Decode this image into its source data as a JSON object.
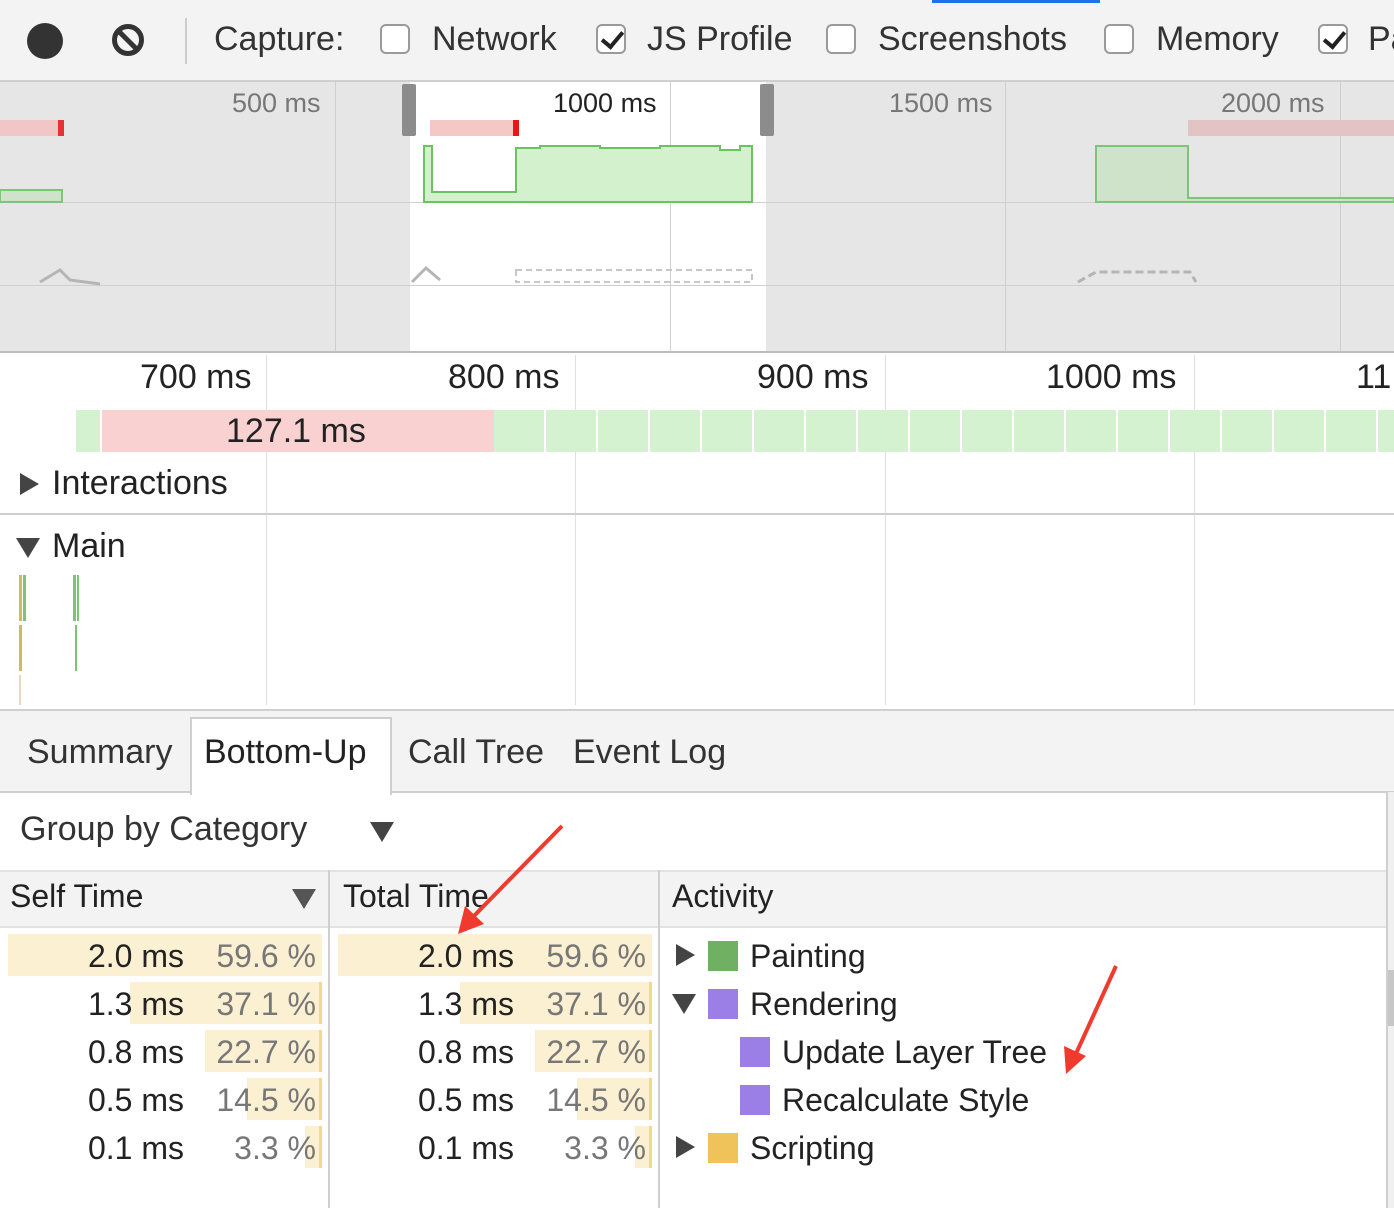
{
  "toolbar": {
    "capture_label": "Capture:",
    "options": [
      {
        "label": "Network",
        "checked": false
      },
      {
        "label": "JS Profile",
        "checked": true
      },
      {
        "label": "Screenshots",
        "checked": false
      },
      {
        "label": "Memory",
        "checked": false
      },
      {
        "label": "Pa",
        "checked": true
      }
    ],
    "icons": [
      "record-icon",
      "clear-icon"
    ]
  },
  "overview": {
    "tick_labels": [
      "500 ms",
      "1000 ms",
      "1500 ms",
      "2000 ms"
    ]
  },
  "flamechart": {
    "tick_labels": [
      "700 ms",
      "800 ms",
      "900 ms",
      "1000 ms",
      "11"
    ],
    "long_frame_label": "127.1 ms",
    "sections": {
      "interactions": "Interactions",
      "main": "Main"
    }
  },
  "tabs": [
    "Summary",
    "Bottom-Up",
    "Call Tree",
    "Event Log"
  ],
  "active_tab": "Bottom-Up",
  "grouping": {
    "selected": "Group by Category"
  },
  "table": {
    "columns": {
      "self_time": "Self Time",
      "total_time": "Total Time",
      "activity": "Activity"
    },
    "rows": [
      {
        "self": "2.0 ms",
        "self_pct": "59.6 %",
        "total": "2.0 ms",
        "total_pct": "59.6 %",
        "pct": 59.6,
        "activity": "Painting",
        "color": "#6fb062",
        "expander": "collapsed"
      },
      {
        "self": "1.3 ms",
        "self_pct": "37.1 %",
        "total": "1.3 ms",
        "total_pct": "37.1 %",
        "pct": 37.1,
        "activity": "Rendering",
        "color": "#9b7fe6",
        "expander": "expanded"
      },
      {
        "self": "0.8 ms",
        "self_pct": "22.7 %",
        "total": "0.8 ms",
        "total_pct": "22.7 %",
        "pct": 22.7,
        "activity": "Update Layer Tree",
        "color": "#9b7fe6",
        "expander": "none"
      },
      {
        "self": "0.5 ms",
        "self_pct": "14.5 %",
        "total": "0.5 ms",
        "total_pct": "14.5 %",
        "pct": 14.5,
        "activity": "Recalculate Style",
        "color": "#9b7fe6",
        "expander": "none"
      },
      {
        "self": "0.1 ms",
        "self_pct": "3.3 %",
        "total": "0.1 ms",
        "total_pct": "3.3 %",
        "pct": 3.3,
        "activity": "Scripting",
        "color": "#f0c35a",
        "expander": "collapsed"
      }
    ]
  },
  "colors": {
    "frame_ok": "#d4f1d0",
    "frame_long": "#f9d1d1",
    "annotation_arrow": "#f03a2e"
  }
}
